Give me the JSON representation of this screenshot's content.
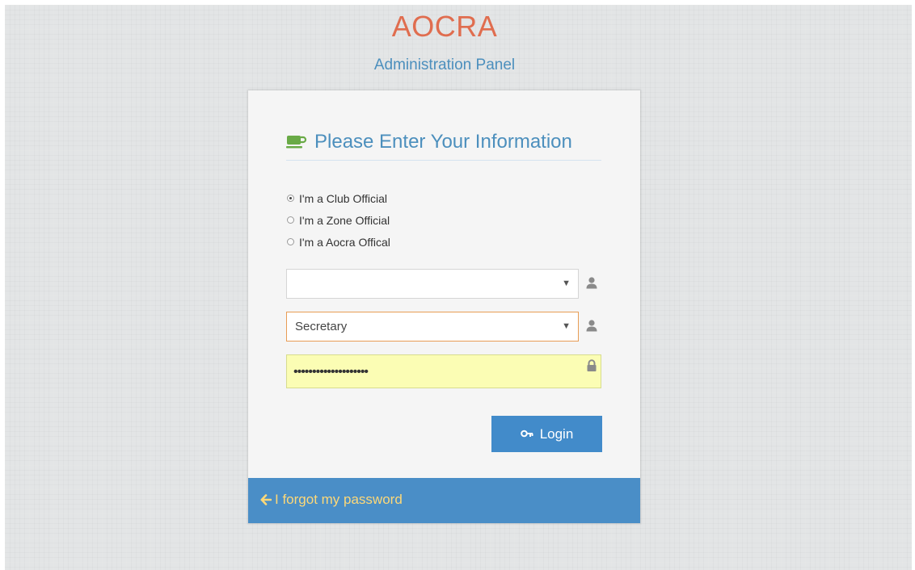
{
  "brand": {
    "title": "AOCRA",
    "subtitle": "Administration Panel"
  },
  "form": {
    "heading": "Please Enter Your Information",
    "radios": [
      {
        "label": "I'm a Club Official",
        "checked": true
      },
      {
        "label": "I'm a Zone Official",
        "checked": false
      },
      {
        "label": "I'm a Aocra Offical",
        "checked": false
      }
    ],
    "select1": {
      "value": ""
    },
    "select2": {
      "value": "Secretary"
    },
    "password": {
      "value": "••••••••••••••••••••"
    },
    "login_label": "Login",
    "forgot_label": "I forgot my password"
  },
  "colors": {
    "accent": "#4c8fbd",
    "title": "#e06d4f",
    "button": "#428bca",
    "footer": "#4a8ec7",
    "footer_link": "#fdd878",
    "password_bg": "#fbfdb4",
    "focus_border": "#e89d55"
  },
  "icons": {
    "heading": "coffee-icon",
    "select1": "user-icon",
    "select2": "user-icon",
    "password": "lock-icon",
    "login": "key-icon",
    "forgot": "arrow-left-icon"
  }
}
